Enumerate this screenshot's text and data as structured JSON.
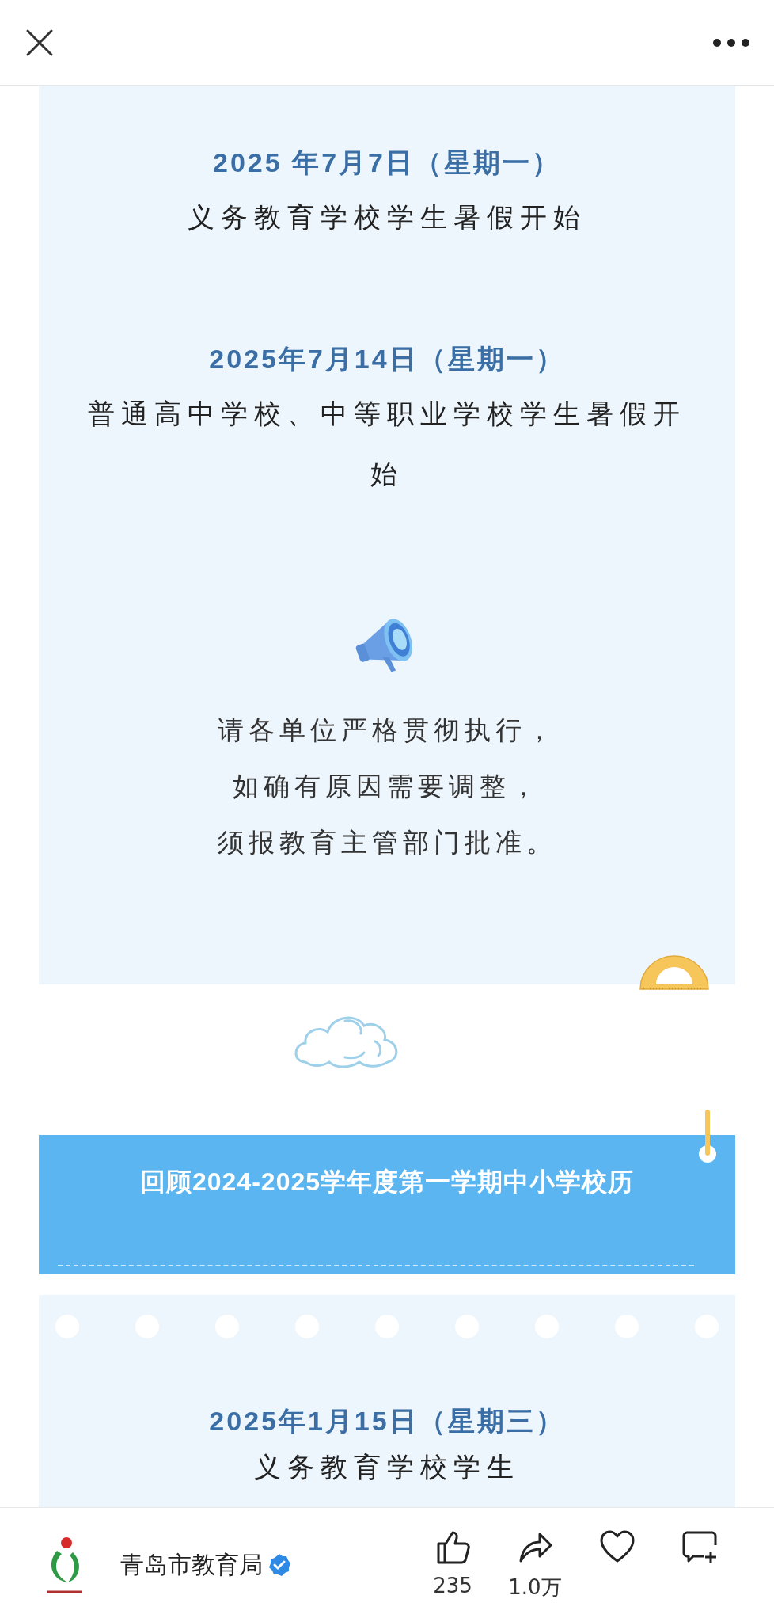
{
  "article": {
    "schedule": [
      {
        "date": "2025 年7月7日（星期一）",
        "text": "义务教育学校学生暑假开始"
      },
      {
        "date": "2025年7月14日（星期一）",
        "text": "普通高中学校、中等职业学校学生暑假开始"
      }
    ],
    "notice": [
      "请各单位严格贯彻执行，",
      "如确有原因需要调整，",
      "须报教育主管部门批准。"
    ],
    "banner": {
      "title": "回顾2024-2025学年度第一学期中小学校历"
    },
    "review": [
      {
        "date": "2025年1月15日（星期三）",
        "text": "义务教育学校学生"
      }
    ]
  },
  "author": {
    "name": "青岛市教育局",
    "verified": true
  },
  "actions": [
    {
      "kind": "like",
      "count": "235"
    },
    {
      "kind": "share",
      "count": "1.0万"
    },
    {
      "kind": "favorite"
    },
    {
      "kind": "comment"
    }
  ]
}
